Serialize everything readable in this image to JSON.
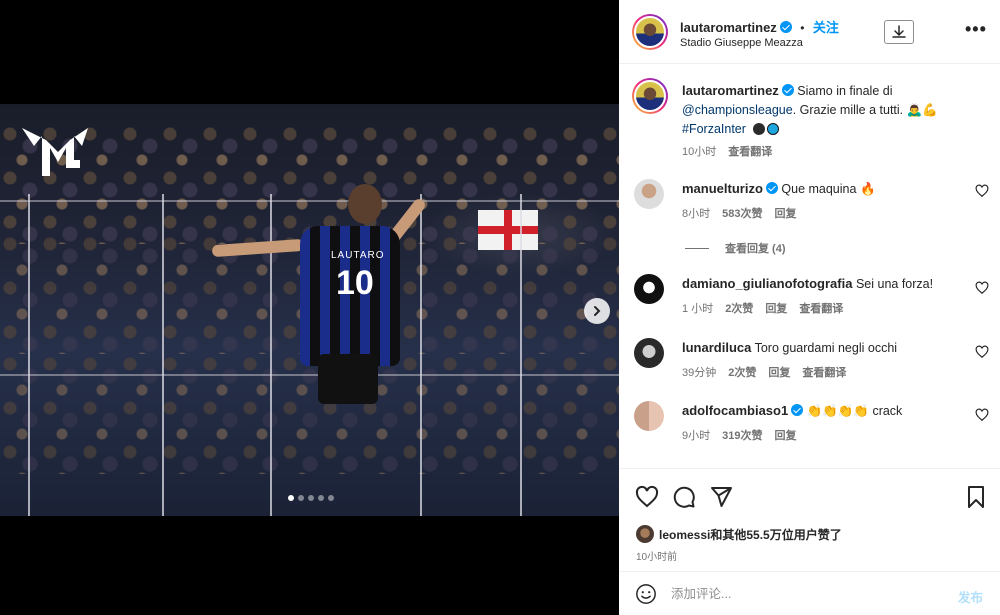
{
  "post": {
    "username": "lautaromartinez",
    "separator": "•",
    "follow_label": "关注",
    "location": "Stadio Giuseppe Meazza",
    "more_label": "•••",
    "photo": {
      "jersey_name": "LAUTARO",
      "jersey_number": "10",
      "carousel_total": 5,
      "carousel_active": 1
    }
  },
  "caption": {
    "username": "lautaromartinez",
    "text_1": "Siamo in finale di",
    "mention": "@championsleague",
    "text_2": ". Grazie mille a tutti.",
    "hashtag": "#ForzaInter",
    "time": "10小时",
    "translate_label": "查看翻译",
    "emoji_colors": [
      "#2b2b2b",
      "#1fa7e1"
    ]
  },
  "comments": [
    {
      "username": "manuelturizo",
      "verified": true,
      "text": "Que maquina",
      "time": "8小时",
      "likes": "583次赞",
      "reply_label": "回复",
      "translate_label": "",
      "replies_label": "查看回复 (4)"
    },
    {
      "username": "damiano_giulianofotografia",
      "verified": false,
      "text": "Sei una forza!",
      "time": "1 小时",
      "likes": "2次赞",
      "reply_label": "回复",
      "translate_label": "查看翻译"
    },
    {
      "username": "lunardiluca",
      "verified": false,
      "text": "Toro guardami negli occhi",
      "time": "39分钟",
      "likes": "2次赞",
      "reply_label": "回复",
      "translate_label": "查看翻译"
    },
    {
      "username": "adolfocambiaso1",
      "verified": true,
      "text": "crack",
      "time": "9小时",
      "likes": "319次赞",
      "reply_label": "回复",
      "translate_label": ""
    }
  ],
  "actions": {
    "likes_text": "leomessi和其他55.5万位用户赞了",
    "time_ago": "10小时前"
  },
  "composer": {
    "placeholder": "添加评论...",
    "post_label": "发布"
  },
  "colors": {
    "accent": "#0095f6",
    "post_disabled": "#b2dffc",
    "text_secondary": "#737373"
  }
}
